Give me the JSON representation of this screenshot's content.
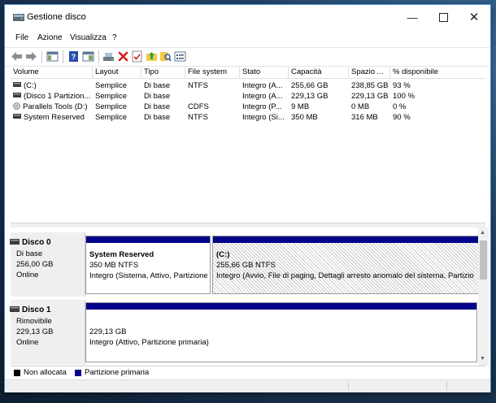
{
  "window": {
    "title": "Gestione disco"
  },
  "menu": [
    "File",
    "Azione",
    "Visualizza",
    "?"
  ],
  "columns": [
    "Volume",
    "Layout",
    "Tipo",
    "File system",
    "Stato",
    "Capacità",
    "Spazio ...",
    "% disponibile"
  ],
  "volumes": [
    [
      "(C:)",
      "Semplice",
      "Di base",
      "NTFS",
      "Integro (A...",
      "255,66 GB",
      "238,85 GB",
      "93 %"
    ],
    [
      "(Disco 1 Partizion...",
      "Semplice",
      "Di base",
      "",
      "Integro (A...",
      "229,13 GB",
      "229,13 GB",
      "100 %"
    ],
    [
      "Parallels Tools (D:)",
      "Semplice",
      "Di base",
      "CDFS",
      "Integro (P...",
      "9 MB",
      "0 MB",
      "0 %"
    ],
    [
      "System Reserved",
      "Semplice",
      "Di base",
      "NTFS",
      "Integro (Si...",
      "350 MB",
      "316 MB",
      "90 %"
    ]
  ],
  "disks": [
    {
      "name": "Disco 0",
      "type": "Di base",
      "size": "256,00 GB",
      "status": "Online",
      "partitions": [
        {
          "title": "System Reserved",
          "size": "350 MB NTFS",
          "status": "Integro (Sistema, Attivo, Partizione"
        },
        {
          "title": "(C:)",
          "size": "255,66 GB NTFS",
          "status": "Integro (Avvio, File di paging, Dettagli arresto anomalo del sistema, Partizio"
        }
      ]
    },
    {
      "name": "Disco 1",
      "type": "Rimovibile",
      "size": "229,13 GB",
      "status": "Online",
      "partitions": [
        {
          "size": "229,13 GB",
          "status": "Integro (Attivo, Partizione primaria)"
        }
      ]
    }
  ],
  "legend": [
    {
      "label": "Non allocata",
      "color": "#000000"
    },
    {
      "label": "Partizione primaria",
      "color": "#04048a"
    }
  ],
  "colors": {
    "primary_partition": "#04048a",
    "accent_border": "#4c8bd0"
  }
}
